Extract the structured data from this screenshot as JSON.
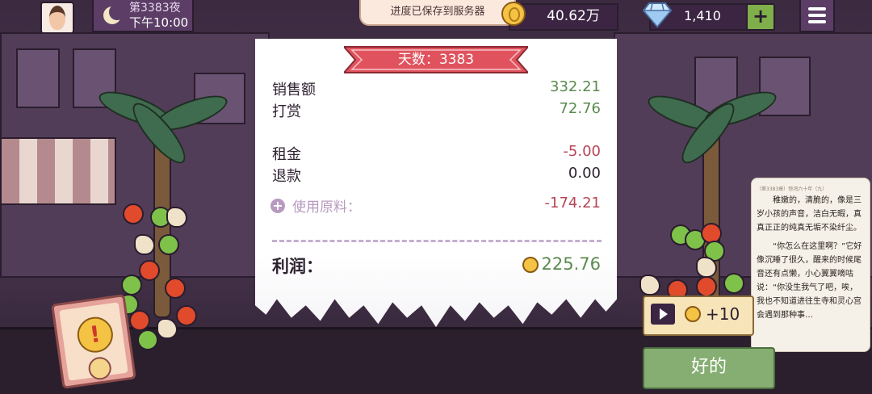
{
  "header": {
    "day_night": "第3383夜",
    "time": "下午10:00",
    "toast": "进度已保存到服务器",
    "coins": "40.62万",
    "gems": "1,410",
    "gems_add": "+"
  },
  "receipt": {
    "title": "天数：3383",
    "rows": [
      {
        "label": "销售额",
        "value": "332.21"
      },
      {
        "label": "打赏",
        "value": "72.76"
      },
      {
        "label": "租金",
        "value": "-5.00"
      },
      {
        "label": "退款",
        "value": "0.00"
      }
    ],
    "ingredients_label": "使用原料：",
    "ingredients_value": "-174.21",
    "profit_label": "利润：",
    "profit_value": "225.76"
  },
  "novel": {
    "header": "（第3383章）惊鸿六十年（九）",
    "para1": "稚嫩的，清脆的，像是三岁小孩的声音，洁白无暇，真真正正的纯真无垢不染纤尘。",
    "para2": "“你怎么在这里啊？”它好像沉睡了很久，醒来的时候尾音还有点懒，小心翼翼嘀咕说：“你没生我气了吧，唉，我也不知道进往生寺和灵心宫会遇到那种事…"
  },
  "ad": {
    "reward": "+10"
  },
  "ok_button": "好的",
  "colors": {
    "profit_green": "#5b8a4e",
    "loss_red": "#b84455",
    "ribbon_red": "#e0535e",
    "ok_green": "#86ad72"
  }
}
